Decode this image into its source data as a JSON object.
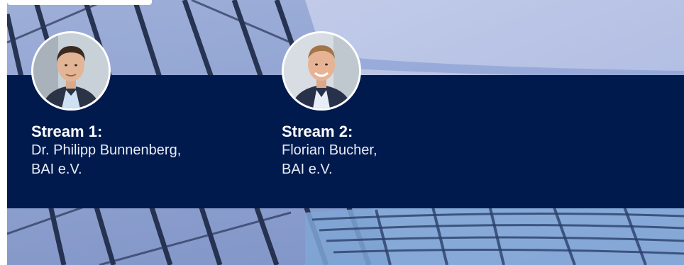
{
  "colors": {
    "panel": "#001a4d",
    "text_primary": "#ffffff",
    "text_secondary": "#e7ecf6"
  },
  "speakers": [
    {
      "stream_label": "Stream 1:",
      "name": "Dr. Philipp Bunnenberg,",
      "organization": "BAI e.V.",
      "avatar_icon": "person-photo-icon"
    },
    {
      "stream_label": "Stream 2:",
      "name": "Florian Bucher,",
      "organization": "BAI e.V.",
      "avatar_icon": "person-photo-icon"
    }
  ]
}
